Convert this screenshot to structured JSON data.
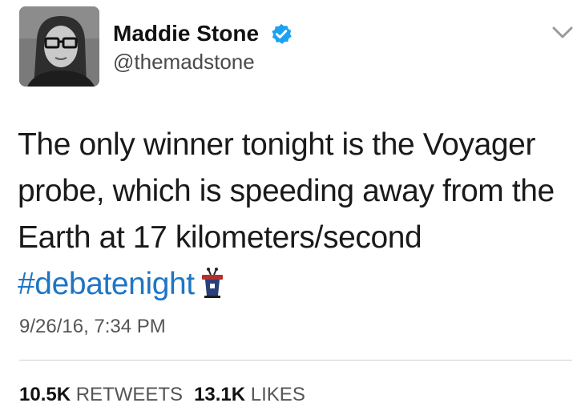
{
  "author": {
    "display_name": "Maddie Stone",
    "handle": "@themadstone",
    "verified_icon": "verified-badge-icon",
    "avatar_icon": "profile-photo"
  },
  "tweet": {
    "lines": [
      "The only winner tonight is the Voyager",
      "probe, which is speeding away from the",
      "Earth at 17 kilometers/second"
    ],
    "hashtag": "#debatenight",
    "hashtag_emoji_icon": "debate-podium-icon",
    "timestamp": "9/26/16, 7:34 PM"
  },
  "stats": {
    "retweets_count": "10.5K",
    "retweets_label": "RETWEETS",
    "likes_count": "13.1K",
    "likes_label": "LIKES"
  },
  "menu_icon": "chevron-down-icon",
  "colors": {
    "link": "#1f75c4",
    "verified": "#1da1f2",
    "text": "#1a1a1a",
    "secondary_text": "#555555",
    "divider": "#cfcfcf"
  }
}
